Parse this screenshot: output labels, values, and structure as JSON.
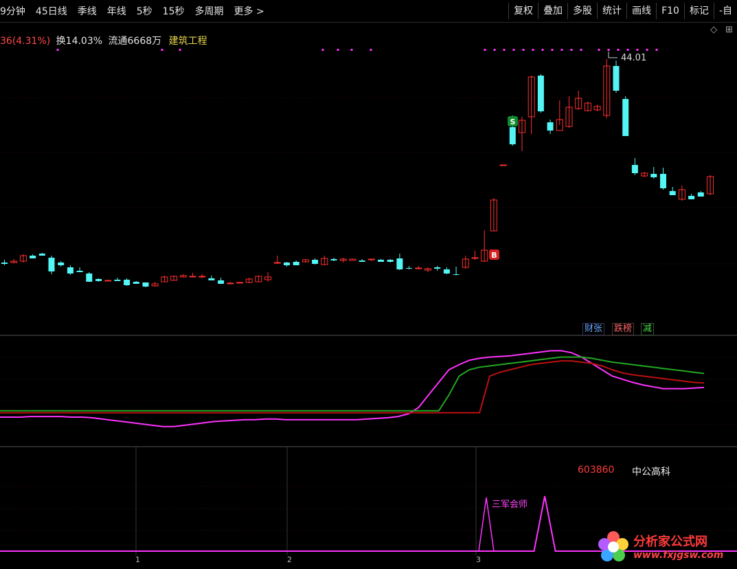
{
  "toolbar": {
    "periods": [
      "9分钟",
      "45日线",
      "季线",
      "年线",
      "5秒",
      "15秒",
      "多周期",
      "更多 >"
    ],
    "buttons": [
      "复权",
      "叠加",
      "多股",
      "统计",
      "画线",
      "F10",
      "标记",
      "-自"
    ]
  },
  "info": {
    "change": "36(4.31%)",
    "turnover": "换14.03%",
    "float": "流通6668万",
    "industry": "建筑工程"
  },
  "chart_data": [
    {
      "type": "candlestick",
      "price_label": "44.01",
      "markers": [
        {
          "label": "S",
          "color": "#0f8a2c"
        },
        {
          "label": "B",
          "color": "#d42020"
        }
      ],
      "candles": [
        [
          382,
          384,
          378,
          386
        ],
        [
          382,
          380,
          377,
          383
        ],
        [
          380,
          372,
          370,
          382
        ],
        [
          372,
          376,
          370,
          376
        ],
        [
          369,
          372,
          368,
          372
        ],
        [
          375,
          395,
          372,
          399
        ],
        [
          382,
          386,
          380,
          388
        ],
        [
          389,
          398,
          386,
          400
        ],
        [
          394,
          396,
          389,
          396
        ],
        [
          398,
          410,
          396,
          410
        ],
        [
          406,
          409,
          405,
          410
        ],
        [
          408,
          408,
          407,
          408
        ],
        [
          407,
          409,
          404,
          409
        ],
        [
          407,
          415,
          405,
          416
        ],
        [
          410,
          413,
          409,
          413
        ],
        [
          411,
          417,
          411,
          418
        ],
        [
          416,
          413,
          410,
          417
        ],
        [
          410,
          403,
          401,
          410
        ],
        [
          408,
          402,
          401,
          408
        ],
        [
          403,
          401,
          399,
          403
        ],
        [
          402,
          402,
          397,
          402
        ],
        [
          403,
          402,
          399,
          405
        ],
        [
          405,
          408,
          401,
          408
        ],
        [
          408,
          413,
          404,
          413
        ],
        [
          412,
          412,
          410,
          412
        ],
        [
          411,
          411,
          410,
          412
        ],
        [
          411,
          406,
          404,
          412
        ],
        [
          410,
          402,
          401,
          410
        ],
        [
          407,
          403,
          396,
          410
        ],
        [
          383,
          382,
          372,
          384
        ],
        [
          382,
          386,
          381,
          388
        ],
        [
          381,
          386,
          379,
          386
        ],
        [
          381,
          378,
          377,
          382
        ],
        [
          378,
          384,
          376,
          385
        ],
        [
          385,
          376,
          372,
          386
        ],
        [
          377,
          379,
          375,
          380
        ],
        [
          379,
          377,
          375,
          382
        ],
        [
          379,
          377,
          377,
          378
        ],
        [
          379,
          381,
          377,
          381
        ],
        [
          378,
          377,
          378,
          380
        ],
        [
          378,
          381,
          377,
          381
        ],
        [
          378,
          381,
          377,
          382
        ],
        [
          376,
          392,
          369,
          393
        ],
        [
          390,
          391,
          387,
          392
        ],
        [
          391,
          390,
          387,
          392
        ],
        [
          393,
          391,
          389,
          396
        ],
        [
          389,
          391,
          387,
          394
        ],
        [
          392,
          398,
          389,
          399
        ],
        [
          399,
          400,
          388,
          401
        ],
        [
          389,
          377,
          372,
          391
        ],
        [
          376,
          375,
          365,
          378
        ],
        [
          380,
          364,
          335,
          381
        ],
        [
          336,
          291,
          288,
          336
        ],
        [
          240,
          240,
          240,
          240
        ],
        [
          185,
          210,
          168,
          212
        ],
        [
          193,
          175,
          170,
          220
        ],
        [
          170,
          112,
          110,
          195
        ],
        [
          110,
          162,
          108,
          164
        ],
        [
          178,
          190,
          174,
          195
        ],
        [
          190,
          174,
          146,
          182
        ],
        [
          184,
          156,
          140,
          186
        ],
        [
          158,
          143,
          132,
          160
        ],
        [
          161,
          150,
          148,
          162
        ],
        [
          160,
          155,
          152,
          162
        ],
        [
          168,
          96,
          86,
          172
        ],
        [
          96,
          132,
          88,
          135
        ],
        [
          144,
          198,
          140,
          198
        ],
        [
          240,
          252,
          230,
          255
        ],
        [
          256,
          252,
          250,
          258
        ],
        [
          253,
          258,
          243,
          260
        ],
        [
          253,
          274,
          244,
          276
        ],
        [
          278,
          284,
          272,
          284
        ],
        [
          290,
          276,
          270,
          292
        ],
        [
          285,
          290,
          282,
          290
        ],
        [
          280,
          286,
          278,
          286
        ],
        [
          282,
          257,
          255,
          284
        ]
      ]
    },
    {
      "type": "line",
      "series": [
        {
          "color": "#ff33ff",
          "values": [
            25,
            25,
            25,
            26,
            26,
            26,
            26,
            25,
            25,
            24,
            22,
            20,
            18,
            16,
            14,
            12,
            10,
            10,
            12,
            14,
            16,
            18,
            19,
            20,
            21,
            21,
            22,
            22,
            21,
            21,
            21,
            21,
            21,
            21,
            21,
            21,
            22,
            23,
            24,
            26,
            30,
            40,
            60,
            80,
            100,
            108,
            115,
            118,
            120,
            121,
            122,
            124,
            126,
            128,
            130,
            130,
            127,
            120,
            110,
            100,
            90,
            85,
            80,
            76,
            73,
            70,
            70,
            70,
            71,
            72
          ]
        },
        {
          "color": "#22aa22",
          "values": [
            35,
            35,
            35,
            35,
            35,
            35,
            35,
            35,
            35,
            35,
            35,
            35,
            35,
            35,
            35,
            35,
            35,
            35,
            35,
            35,
            35,
            35,
            35,
            35,
            35,
            35,
            35,
            35,
            35,
            35,
            35,
            35,
            35,
            35,
            35,
            35,
            35,
            35,
            35,
            35,
            35,
            35,
            35,
            35,
            60,
            90,
            100,
            104,
            106,
            108,
            110,
            112,
            114,
            116,
            118,
            120,
            120,
            120,
            118,
            115,
            112,
            110,
            108,
            106,
            104,
            102,
            100,
            98,
            96,
            94
          ]
        },
        {
          "color": "#bb1111",
          "values": [
            32,
            32,
            32,
            32,
            32,
            32,
            32,
            32,
            32,
            32,
            32,
            32,
            32,
            32,
            32,
            32,
            32,
            32,
            32,
            32,
            32,
            32,
            32,
            32,
            32,
            32,
            32,
            32,
            32,
            32,
            32,
            32,
            32,
            32,
            32,
            32,
            32,
            32,
            32,
            32,
            32,
            32,
            32,
            32,
            32,
            32,
            32,
            32,
            90,
            96,
            100,
            104,
            108,
            110,
            112,
            114,
            114,
            112,
            110,
            106,
            100,
            95,
            92,
            90,
            88,
            86,
            84,
            82,
            80,
            79
          ]
        }
      ]
    },
    {
      "type": "line",
      "signal_label": "三军会师",
      "x_labels": [
        "1",
        "2",
        "3"
      ],
      "series": [
        {
          "color": "#ff33ff",
          "values": [
            0,
            0,
            0,
            0,
            0,
            0,
            0,
            0,
            0,
            0,
            0,
            0,
            0,
            0,
            0,
            0,
            0,
            0,
            0,
            0,
            0,
            0,
            0,
            0,
            0,
            0,
            0,
            0,
            0,
            0,
            0,
            0,
            0,
            0,
            0,
            0,
            0,
            0,
            0,
            0,
            0,
            0,
            0,
            0,
            0,
            0,
            0,
            0,
            0,
            0,
            0,
            100,
            0,
            0,
            0,
            0,
            0,
            0,
            0,
            0,
            0,
            0,
            0,
            0,
            0,
            0,
            0,
            0,
            0,
            0
          ]
        }
      ]
    }
  ],
  "badges": {
    "cai": "财张",
    "long": "跌榜",
    "jian": "减"
  },
  "stock": {
    "code": "603860",
    "name": "中公高科"
  },
  "watermark": {
    "title": "分析家公式网",
    "url": "www.fxjgsw.com"
  },
  "colors": {
    "up": "#ff3030",
    "down": "#54f5f5",
    "pink": "#ff33ff"
  }
}
